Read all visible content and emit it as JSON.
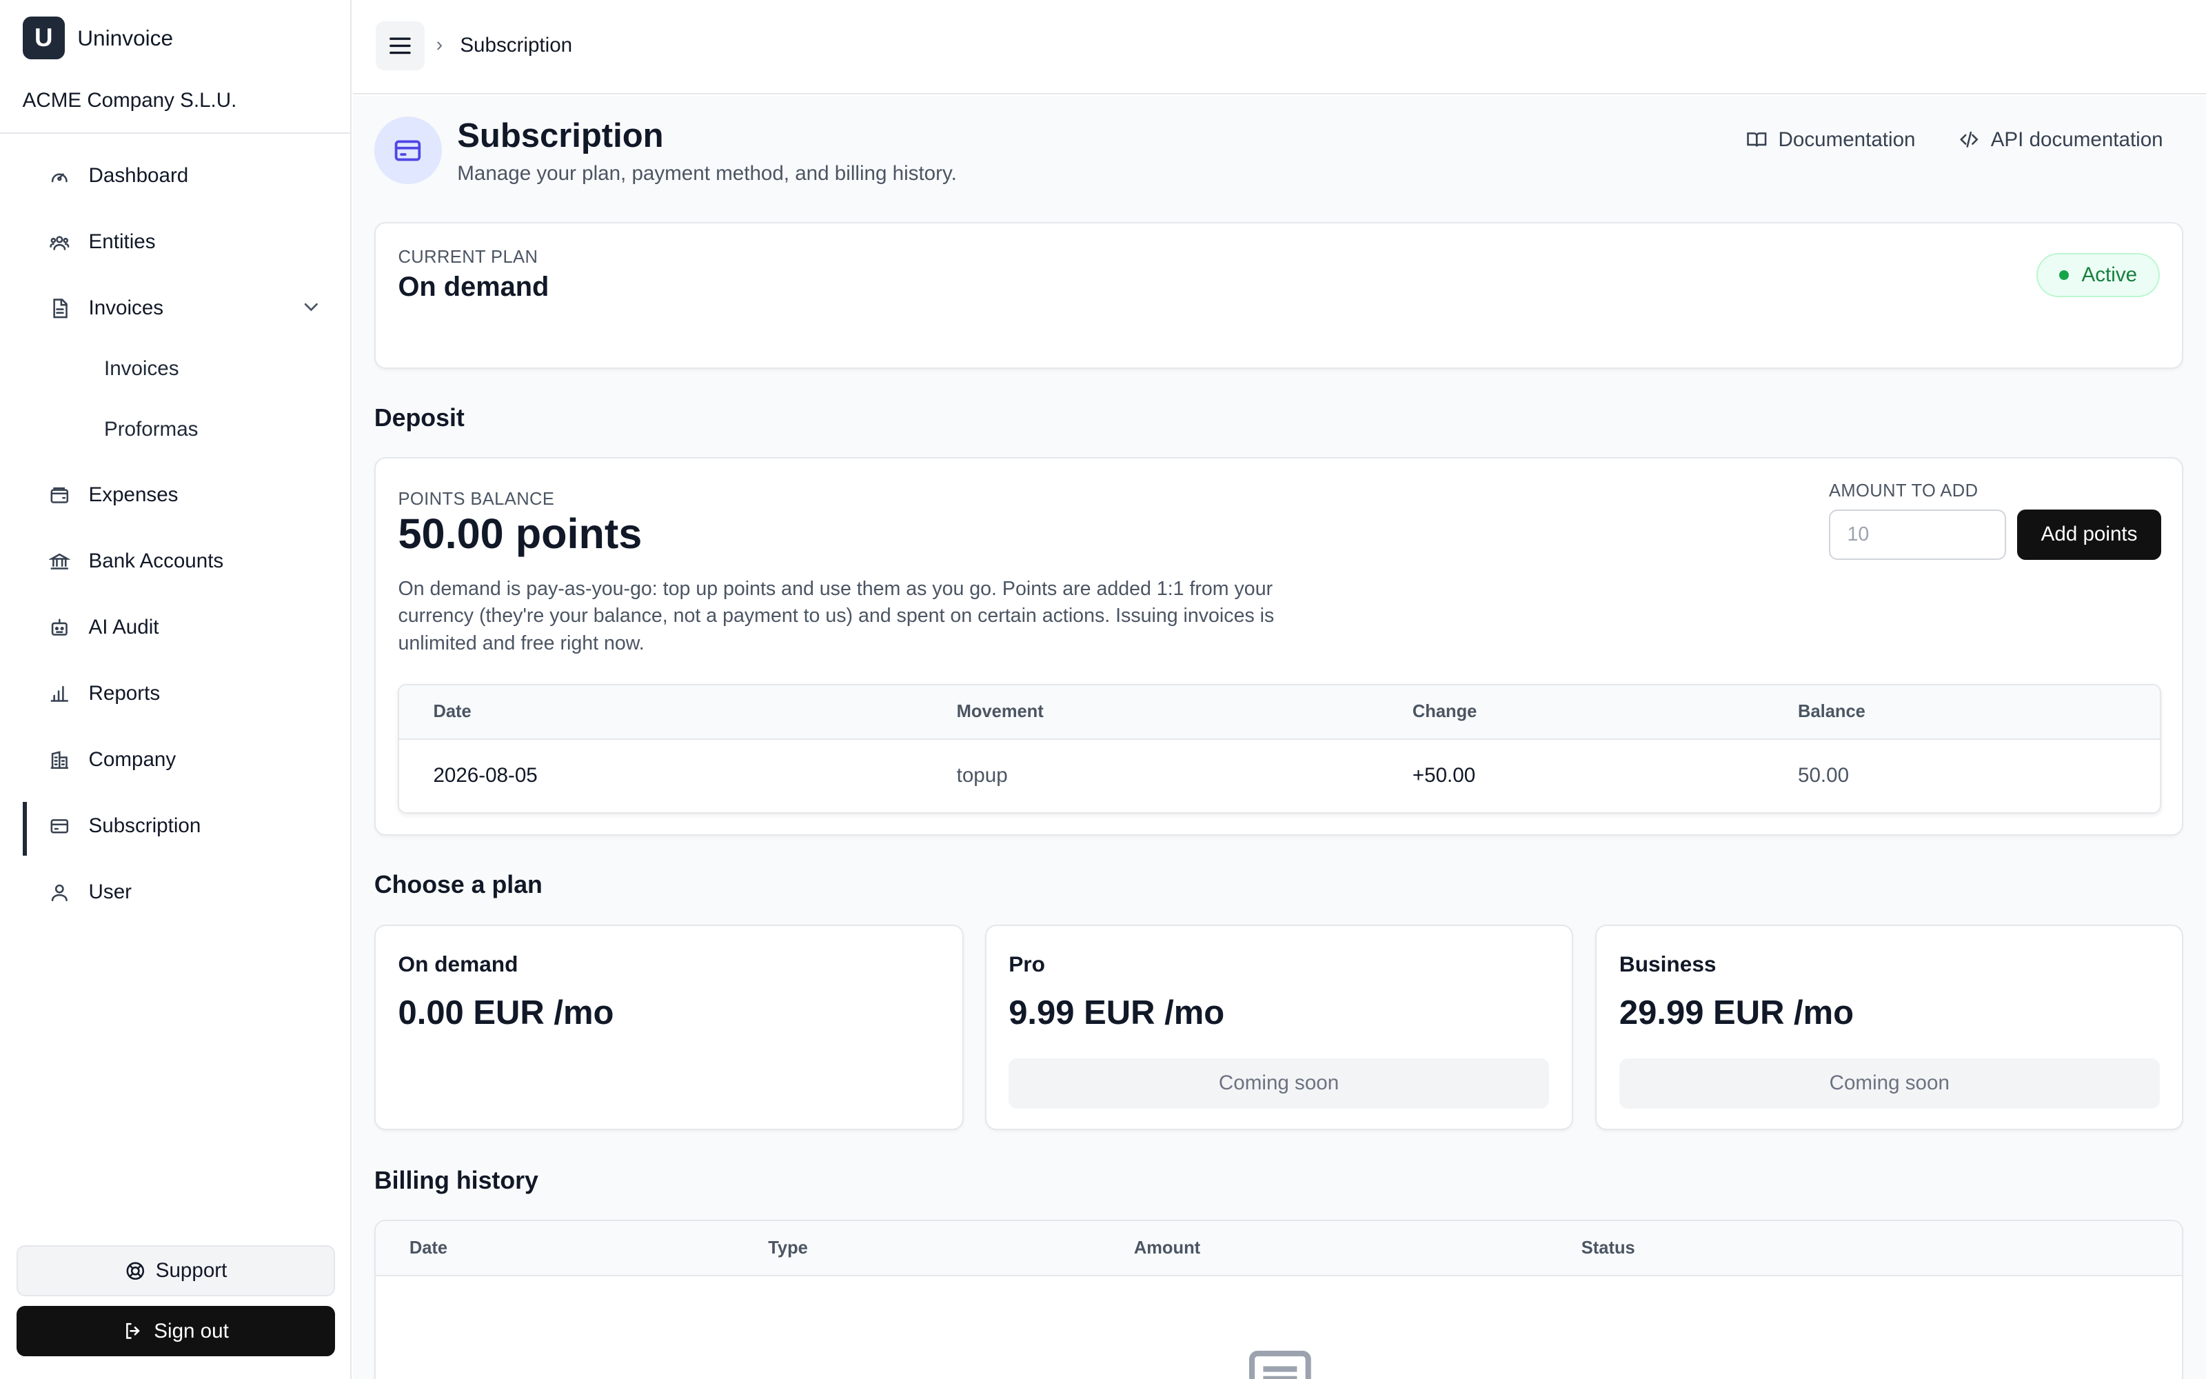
{
  "app": {
    "logo_letter": "U",
    "name": "Uninvoice",
    "company": "ACME Company S.L.U."
  },
  "sidebar": {
    "items": [
      {
        "label": "Dashboard",
        "icon": "gauge-icon"
      },
      {
        "label": "Entities",
        "icon": "users-icon"
      },
      {
        "label": "Invoices",
        "icon": "file-text-icon",
        "expanded": true,
        "children": [
          {
            "label": "Invoices"
          },
          {
            "label": "Proformas"
          }
        ]
      },
      {
        "label": "Expenses",
        "icon": "wallet-icon"
      },
      {
        "label": "Bank Accounts",
        "icon": "bank-icon"
      },
      {
        "label": "AI Audit",
        "icon": "bot-icon"
      },
      {
        "label": "Reports",
        "icon": "bar-chart-icon"
      },
      {
        "label": "Company",
        "icon": "building-icon"
      },
      {
        "label": "Subscription",
        "icon": "credit-card-icon",
        "active": true
      },
      {
        "label": "User",
        "icon": "user-icon"
      }
    ],
    "support_label": "Support",
    "signout_label": "Sign out"
  },
  "topbar": {
    "breadcrumb_separator": "›",
    "breadcrumb": "Subscription"
  },
  "header": {
    "title": "Subscription",
    "subtitle": "Manage your plan, payment method, and billing history.",
    "links": [
      "Documentation",
      "API documentation"
    ]
  },
  "current_plan": {
    "label": "CURRENT PLAN",
    "name": "On demand",
    "status": "Active",
    "status_color": "#16a34a"
  },
  "deposit": {
    "title": "Deposit",
    "balance_label": "POINTS BALANCE",
    "balance": "50.00 points",
    "description": "On demand is pay-as-you-go: top up points and use them as you go. Points are added 1:1 from your currency (they're your balance, not a payment to us) and spent on certain actions. Issuing invoices is unlimited and free right now.",
    "amount_label": "AMOUNT TO ADD",
    "amount_placeholder": "10",
    "add_button": "Add points",
    "table": {
      "columns": [
        "Date",
        "Movement",
        "Change",
        "Balance"
      ],
      "rows": [
        {
          "date": "2026-08-05",
          "movement": "topup",
          "change": "+50.00",
          "balance": "50.00"
        }
      ]
    }
  },
  "plans": {
    "title": "Choose a plan",
    "items": [
      {
        "name": "On demand",
        "price": "0.00 EUR /mo",
        "action": ""
      },
      {
        "name": "Pro",
        "price": "9.99 EUR /mo",
        "action": "Coming soon"
      },
      {
        "name": "Business",
        "price": "29.99 EUR /mo",
        "action": "Coming soon"
      }
    ]
  },
  "billing": {
    "title": "Billing history",
    "columns": [
      "Date",
      "Type",
      "Amount",
      "Status"
    ]
  },
  "colors": {
    "accent": "#111111",
    "active_green": "#16a34a",
    "icon_bg": "#e0e7ff",
    "icon_fg": "#4f46e5"
  }
}
